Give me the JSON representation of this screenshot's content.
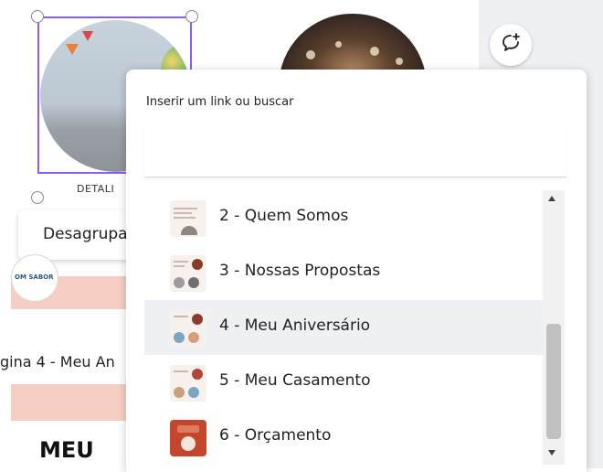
{
  "canvas": {
    "detail_label": "DETALI",
    "ungroup_label": "Desagrupar",
    "logo_text": "OM SABOR",
    "page_label": "gina 4 - Meu An",
    "heading": "MEU"
  },
  "link_popup": {
    "title": "Inserir um link ou buscar",
    "input_value": "",
    "items": [
      {
        "label": "2 - Quem Somos",
        "highlighted": false
      },
      {
        "label": "3 - Nossas Propostas",
        "highlighted": false
      },
      {
        "label": "4 - Meu Aniversário",
        "highlighted": true
      },
      {
        "label": "5 - Meu Casamento",
        "highlighted": false
      },
      {
        "label": "6 - Orçamento",
        "highlighted": false
      }
    ]
  },
  "icons": {
    "comment": "add-comment-icon",
    "scroll_up": "scroll-up-arrow-icon",
    "scroll_down": "scroll-down-arrow-icon"
  },
  "colors": {
    "selection": "#8b5cf6",
    "highlight_row": "#eef0f4",
    "pink_band": "#f6cfc4"
  }
}
